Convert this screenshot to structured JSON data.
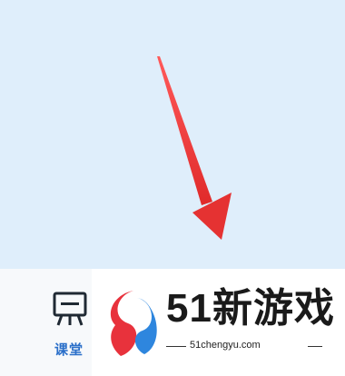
{
  "background": {
    "upper_color": "#dfeefb",
    "bottom_color": "#f7f9fb"
  },
  "annotation": {
    "icon": "red-arrow-pointing-down",
    "color": "#ec3b3b"
  },
  "toolbar": {
    "classroom_label": "课堂",
    "classroom_icon": "presentation-board-icon",
    "accent_color": "#2a6fc9"
  },
  "watermark": {
    "brand_text": "51新游戏",
    "domain": "51chengyu.com",
    "logo_colors": [
      "#e8323c",
      "#2e86de"
    ]
  }
}
